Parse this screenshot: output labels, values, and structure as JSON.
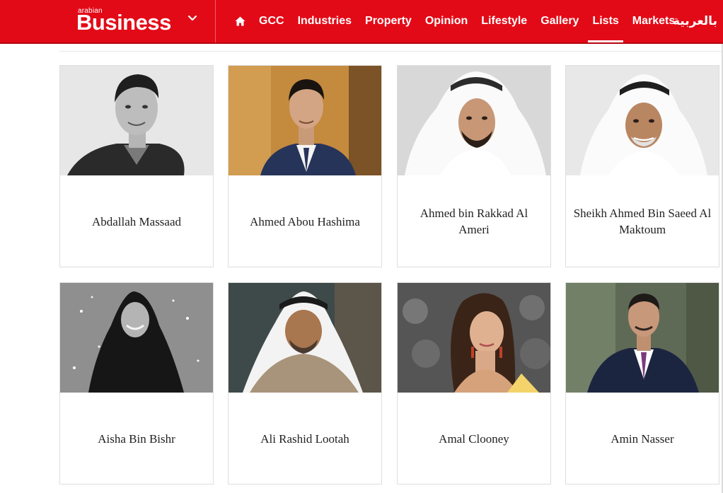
{
  "header": {
    "logo_small": "arabian",
    "logo_big": "Business",
    "nav": [
      {
        "label": "GCC"
      },
      {
        "label": "Industries"
      },
      {
        "label": "Property"
      },
      {
        "label": "Opinion"
      },
      {
        "label": "Lifestyle"
      },
      {
        "label": "Gallery"
      },
      {
        "label": "Lists"
      },
      {
        "label": "Markets"
      }
    ],
    "arabic_label": "بالعربية",
    "active_item": "Lists",
    "brand_color": "#e30a17"
  },
  "cards": [
    {
      "name": "Abdallah Massaad"
    },
    {
      "name": "Ahmed Abou Hashima"
    },
    {
      "name": "Ahmed bin Rakkad Al Ameri"
    },
    {
      "name": "Sheikh Ahmed Bin Saeed Al Maktoum"
    },
    {
      "name": "Aisha Bin Bishr"
    },
    {
      "name": "Ali Rashid Lootah"
    },
    {
      "name": "Amal Clooney"
    },
    {
      "name": "Amin Nasser"
    }
  ]
}
